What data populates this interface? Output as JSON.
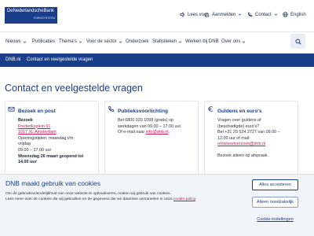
{
  "logo": {
    "line1": "DeNederlandscheBank",
    "line2": "EUROSYSTEEM"
  },
  "utility": {
    "lees_voor": "Lees voor",
    "aanmelden": "Aanmelden",
    "contact": "Contact",
    "english": "English"
  },
  "nav": {
    "items": [
      {
        "label": "Nieuws"
      },
      {
        "label": "Publicaties"
      },
      {
        "label": "Thema's"
      },
      {
        "label": "Voor de sector"
      },
      {
        "label": "Onderzoek"
      },
      {
        "label": "Statistieken"
      },
      {
        "label": "Werken bij DNB"
      },
      {
        "label": "Over ons"
      }
    ]
  },
  "breadcrumb": {
    "home": "DNB.nl",
    "separator": "›",
    "current": "Contact en veelgestelde vragen"
  },
  "page_title": "Contact en veelgestelde vragen",
  "cards": [
    {
      "title": "Bezoek en post",
      "subheading": "Bezoek",
      "address1": "Frederiksplein 61",
      "address2": "1017 XL Amsterdam",
      "hours1": "Openingstijden: maandag t/m",
      "hours2": "vrijdag",
      "hours3": "09.00 – 17.00 uur",
      "notice": "Woensdag 26 maart geopend tot",
      "notice_cut": "14.00 uur"
    },
    {
      "title": "Publieksvoorlichting",
      "line1": "Bel 0800 020 1068 (gratis) op",
      "line2": "werkdagen van 09.00 – 17.00 uur.",
      "line3_prefix": "Of e-mail naar ",
      "email": "info@dnb.nl",
      "line3_suffix": "."
    },
    {
      "title": "Guldens en euro's",
      "line1": "Vragen over guldens of",
      "line2": "(beschadigde) euro's?",
      "line3": "Bel +31 20 524 2727 van 09.00 –",
      "line4": "12.00 uur of mail:",
      "email": "omwisselverzoek@dnb.nl",
      "line5": "Bezoek alleen op afspraak."
    }
  ],
  "cookie": {
    "title": "DNB maakt gebruik van cookies",
    "text1": "Om de gebruiksvriendelijkheid van onze website te optimaliseren, maken wij gebruik van cookies.",
    "text2_prefix": "Lees meer over de cookies die wij gebruiken en de gegevens die we daarmee verzamelen in onze ",
    "policy_link": "cookie-policy",
    "text2_suffix": ".",
    "accept_all": "Alles accepteren",
    "necessary_only": "Alleen noodzakelijk",
    "settings": "Cookie-instellingen"
  },
  "colors": {
    "brand_blue": "#1b3e8a",
    "link_pink": "#c2185b",
    "banner_bg": "#f1f4f9"
  }
}
